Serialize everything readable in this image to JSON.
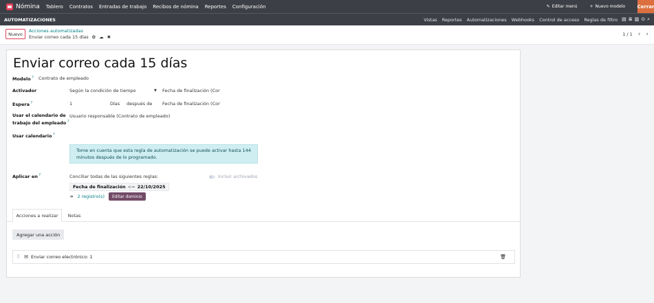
{
  "navbar": {
    "app_name": "Nómina",
    "menu": [
      "Tablero",
      "Contratos",
      "Entradas de trabajo",
      "Recibos de nómina",
      "Reportes",
      "Configuración"
    ],
    "edit_menu": "Editar menú",
    "new_model": "Nuevo modelo",
    "close": "Cerrar"
  },
  "subbar": {
    "title": "AUTOMATIZACIONES",
    "menu": [
      "Vistas",
      "Reportes",
      "Automatizaciones",
      "Webhooks",
      "Control de acceso",
      "Reglas de filtro"
    ]
  },
  "control_panel": {
    "new_button": "Nuevo",
    "breadcrumb_parent": "Acciones automatizadas",
    "breadcrumb_current": "Enviar correo cada 15 días",
    "pager": "1 / 1"
  },
  "record": {
    "title": "Enviar correo cada 15 días",
    "model_label": "Modelo",
    "model_value": "Contrato de empleado",
    "trigger_label": "Activador",
    "trigger_value": "Según la condición de tiempo",
    "trigger_field": "Fecha de finalización (Cor",
    "wait_label": "Espera",
    "wait_amount": "1",
    "wait_unit": "Días",
    "wait_relation": "después de",
    "wait_field": "Fecha de finalización (Cor",
    "calendar_label_1": "Usar el calendario de",
    "calendar_label_2": "trabajo del empleado",
    "calendar_value": "Usuario responsable (Contrato de empleado)",
    "use_calendar_label": "Usar calendario",
    "alert_line1": "Tome en cuenta que esta regla de automatización se puede activar hasta 144",
    "alert_line2": "minutos después de lo programado.",
    "apply_label": "Aplicar en",
    "apply_text": "Conciliar todas de las siguientes reglas:",
    "include_archived": "Incluir archivados",
    "domain_field": "Fecha de finalización",
    "domain_operator": "<=",
    "domain_value": "22/10/2025",
    "records_link": "2 registro(s)",
    "edit_domain": "Editar dominio"
  },
  "tabs": [
    "Acciones a realizar",
    "Notas"
  ],
  "actions": {
    "add_button": "Agregar una acción",
    "items": [
      "Enviar correo electrónico: 1"
    ]
  }
}
